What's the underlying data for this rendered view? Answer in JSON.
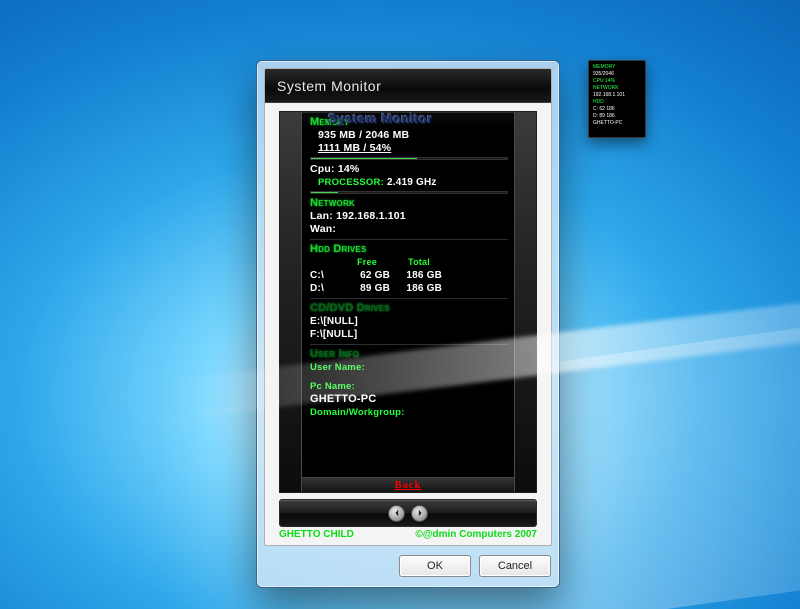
{
  "window": {
    "title": "System Monitor"
  },
  "gadget": {
    "watermark": "System Monitor",
    "sections": {
      "memory": {
        "header": "Memory",
        "line1": "935 MB / 2046 MB",
        "line2": "1111 MB / 54%",
        "bar_pct": 54
      },
      "cpu": {
        "label": "Cpu:",
        "value": "14%",
        "processor_label": "Processor:",
        "processor_value": "2.419 GHz",
        "bar_pct": 14
      },
      "network": {
        "header": "Network",
        "lan_label": "Lan:",
        "lan_value": "192.168.1.101",
        "wan_label": "Wan:",
        "wan_value": ""
      },
      "hdd": {
        "header": "Hdd Drives",
        "col_free": "Free",
        "col_total": "Total",
        "rows": [
          {
            "name": "C:\\",
            "free": "62 GB",
            "total": "186 GB"
          },
          {
            "name": "D:\\",
            "free": "89 GB",
            "total": "186 GB"
          }
        ]
      },
      "optical": {
        "header": "CD/DVD Drives",
        "rows": [
          {
            "name": "E:\\",
            "value": "[NULL]"
          },
          {
            "name": "F:\\",
            "value": "[NULL]"
          }
        ]
      },
      "user": {
        "header": "User Info",
        "username_label": "User Name:",
        "username_value": "",
        "pcname_label": "Pc Name:",
        "pcname_value": "GHETTO-PC",
        "domain_label": "Domain/Workgroup:",
        "domain_value": ""
      }
    },
    "back_label": "Back"
  },
  "credits": {
    "left": "GHETTO CHILD",
    "right": "©@dmin Computers 2007"
  },
  "buttons": {
    "ok": "OK",
    "cancel": "Cancel"
  },
  "mini": {
    "l1": "MEMORY",
    "l2": "935/2046",
    "l3": "CPU 14%",
    "l4": "NETWORK",
    "l5": "192.168.1.101",
    "l6": "HDD",
    "l7": "C: 62 186",
    "l8": "D: 89 186",
    "l9": "GHETTO-PC"
  }
}
